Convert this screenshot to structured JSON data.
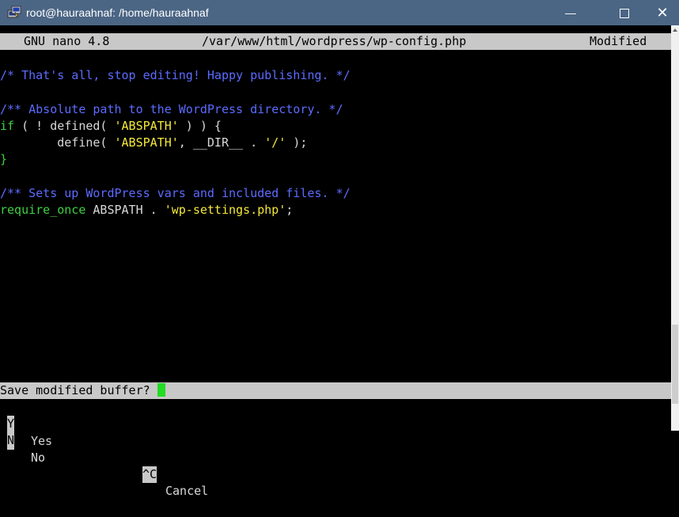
{
  "window": {
    "title": "root@hauraahnaf: /home/hauraahnaf",
    "min_glyph": "—",
    "close_glyph": "✕",
    "colors": {
      "titlebar": "#4b6584",
      "terminal_bg": "#000000",
      "header_bg": "#c8c8c8",
      "comment": "#5c6bff",
      "keyword": "#3fd13f",
      "string": "#f5e83a",
      "cursor": "#22dd22"
    }
  },
  "nano": {
    "version": "GNU nano 4.8",
    "filename": "/var/www/html/wordpress/wp-config.php",
    "status": "Modified"
  },
  "code": {
    "line1": "/* That's all, stop editing! Happy publishing. */",
    "line2": "/** Absolute path to the WordPress directory. */",
    "line3_kw": "if",
    "line3_rest": " ( ! defined( ",
    "line3_str": "'ABSPATH'",
    "line3_end": " ) ) {",
    "line4_pre": "        define( ",
    "line4_str1": "'ABSPATH'",
    "line4_mid": ", __DIR__ . ",
    "line4_str2": "'/'",
    "line4_end": " );",
    "line5": "}",
    "line6": "/** Sets up WordPress vars and included files. */",
    "line7_kw": "require_once",
    "line7_mid": " ABSPATH . ",
    "line7_str": "'wp-settings.php'",
    "line7_end": ";"
  },
  "prompt": {
    "text": "Save modified buffer? ",
    "options": [
      {
        "key": "Y",
        "label": "Yes"
      },
      {
        "key": "N",
        "label": "No"
      },
      {
        "key": "^C",
        "label": "Cancel"
      }
    ]
  }
}
